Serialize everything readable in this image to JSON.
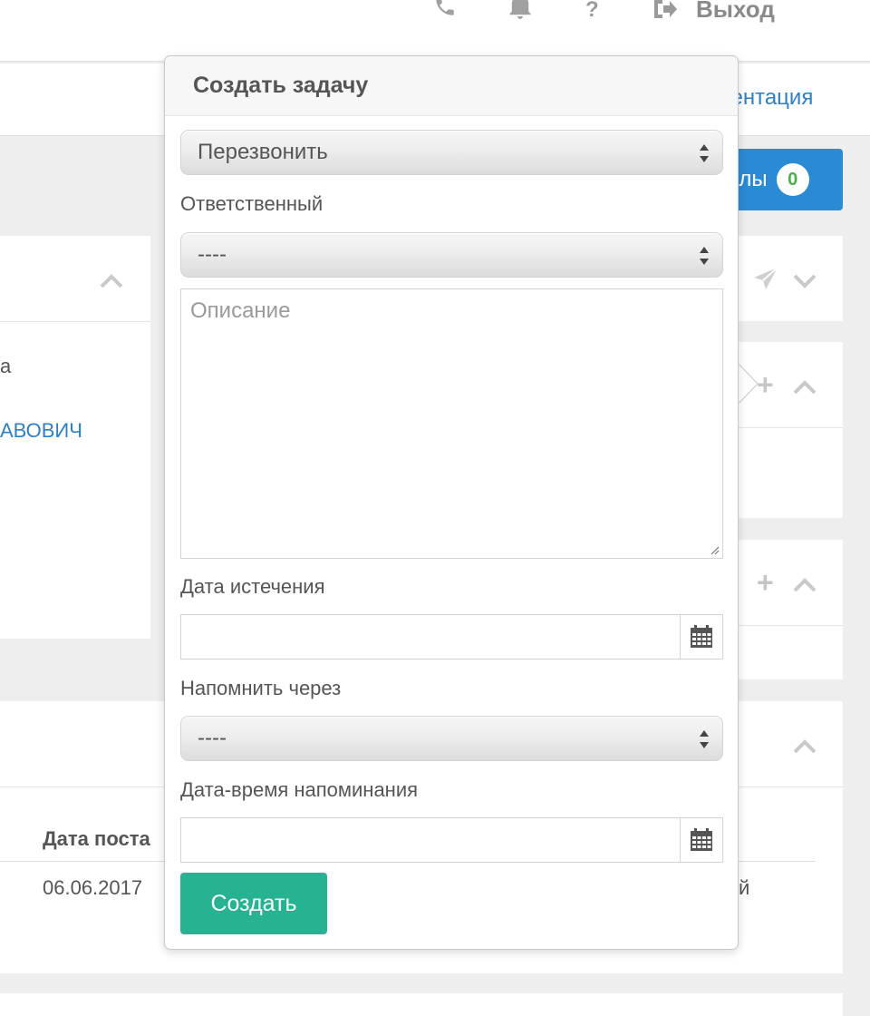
{
  "topbar": {
    "icons": [
      "phone-icon",
      "bell-icon",
      "help-icon",
      "logout-icon"
    ],
    "help_label": "?",
    "exit_label": "Выход"
  },
  "subbar": {
    "doc_link": "ментация"
  },
  "files_button": {
    "label": "йлы",
    "count": "0"
  },
  "background": {
    "left_fragment_1": "а",
    "left_fragment_2": "АВОВИЧ",
    "table_header": "Дата поста",
    "table_cell": "06.06.2017",
    "right_cell": "й"
  },
  "popover": {
    "title": "Создать задачу",
    "task_type": {
      "value": "Перезвонить"
    },
    "responsible": {
      "label": "Ответственный",
      "value": "----"
    },
    "description": {
      "placeholder": "Описание"
    },
    "expiry": {
      "label": "Дата истечения",
      "value": ""
    },
    "remind_in": {
      "label": "Напомнить через",
      "value": "----"
    },
    "remind_at": {
      "label": "Дата-время напоминания",
      "value": ""
    },
    "submit_label": "Создать"
  },
  "colors": {
    "primary_blue": "#2a8ad4",
    "link_blue": "#2f7fc1",
    "submit_green": "#27b392",
    "badge_green": "#4cae4c"
  }
}
